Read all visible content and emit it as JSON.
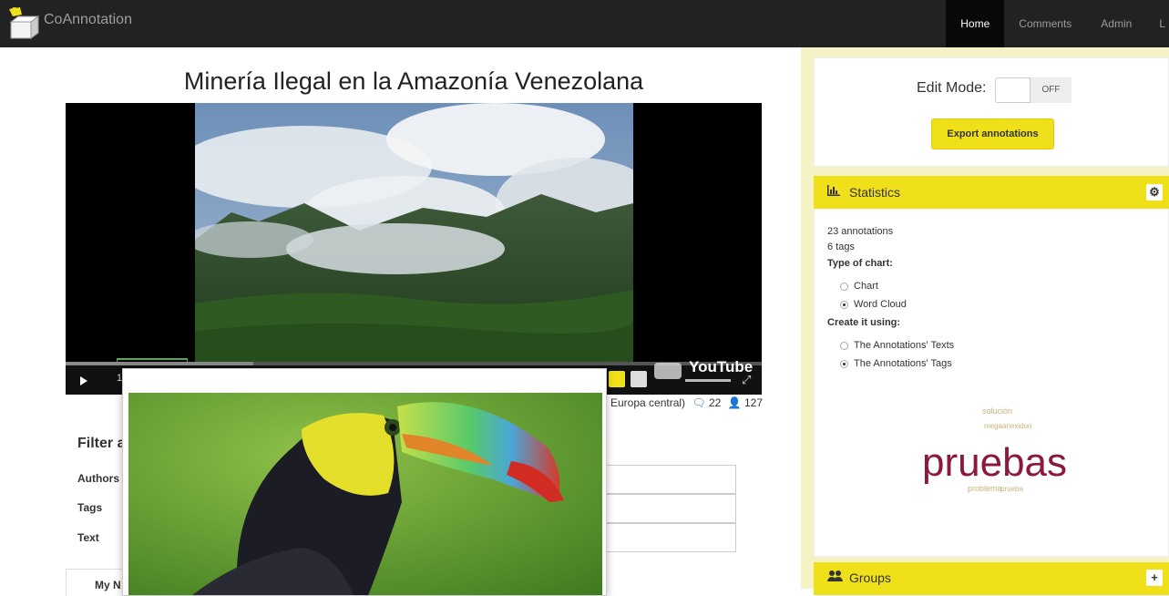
{
  "app": {
    "name": "CoAnnotation"
  },
  "nav": {
    "items": [
      "Home",
      "Comments",
      "Admin",
      "L"
    ],
    "active": "Home"
  },
  "page": {
    "title": "Minería Ilegal en la Amazonía Venezolana"
  },
  "video": {
    "time_label": "1",
    "progress": 0.27,
    "branding": "YouTube",
    "meta_location": "Europa central)",
    "comment_count": "22",
    "user_count": "127"
  },
  "filter": {
    "title": "Filter a",
    "authors_label": "Authors",
    "tags_label": "Tags",
    "text_label": "Text"
  },
  "tabs": {
    "my_label": "My N"
  },
  "edit": {
    "label": "Edit Mode:",
    "toggle_value": "OFF"
  },
  "export": {
    "label": "Export annotations"
  },
  "statistics": {
    "title": "Statistics",
    "annotations": "23 annotations",
    "tags": "6 tags",
    "chart_type_label": "Type of chart:",
    "chart_options": [
      "Chart",
      "Word Cloud"
    ],
    "chart_selected": "Word Cloud",
    "create_label": "Create it using:",
    "create_options": [
      "The Annotations' Texts",
      "The Annotations' Tags"
    ],
    "create_selected": "The Annotations' Tags",
    "settings_icon": "gear-icon"
  },
  "word_cloud": {
    "words": [
      "solución",
      "megaanexidoo",
      "pruebas",
      "problema",
      "prueba"
    ]
  },
  "groups": {
    "title": "Groups",
    "add_icon": "plus-icon"
  },
  "colors": {
    "accent": "#f0e01a",
    "navbar": "#222222",
    "wordcloud": "#8b1a3a",
    "sidebar_bg": "#f5f2c6"
  }
}
